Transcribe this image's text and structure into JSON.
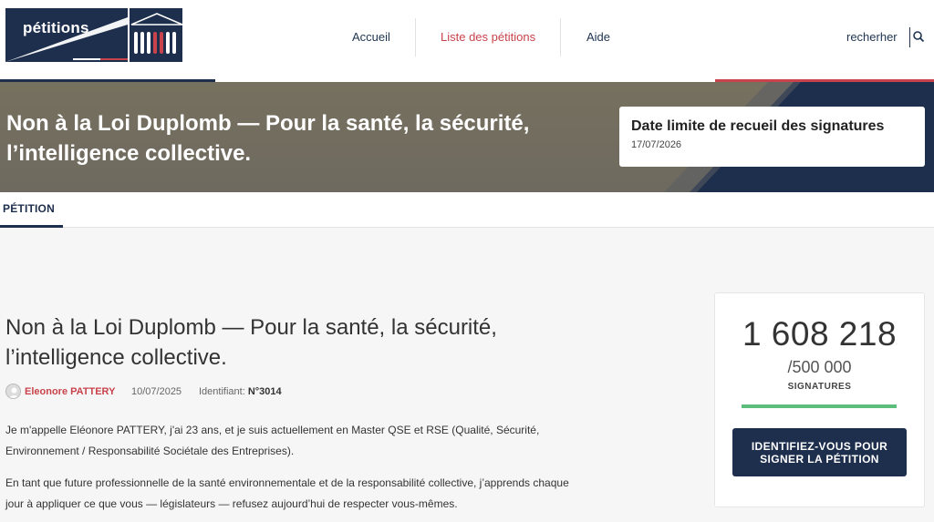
{
  "header": {
    "logo_text": "pétitions",
    "nav": [
      {
        "label": "Accueil",
        "active": false
      },
      {
        "label": "Liste des pétitions",
        "active": true
      },
      {
        "label": "Aide",
        "active": false
      }
    ],
    "search_label": "recherher"
  },
  "banner": {
    "title": "Non à la Loi Duplomb — Pour la santé, la sécurité, l’intelligence collective.",
    "deadline_label": "Date limite de recueil des signatures",
    "deadline_date": "17/07/2026"
  },
  "tabs": [
    {
      "label": "PÉTITION",
      "active": true
    }
  ],
  "petition": {
    "title": "Non à la Loi Duplomb — Pour la santé, la sécurité, l’intelligence collective.",
    "author": "Eleonore PATTERY",
    "date": "10/07/2025",
    "identifier_label": "Identifiant:",
    "identifier": "N°3014",
    "paragraphs": [
      "Je m'appelle Eléonore PATTERY, j'ai 23 ans, et je suis actuellement en Master QSE et RSE (Qualité, Sécurité, Environnement / Responsabilité Sociétale des Entreprises).",
      "En tant que future professionnelle de la santé environnementale et de la responsabilité collective, j’apprends chaque jour à appliquer ce que vous — législateurs — refusez aujourd’hui de respecter vous-mêmes."
    ]
  },
  "signatures": {
    "count": "1 608 218",
    "goal": "/500 000",
    "label": "SIGNATURES",
    "progress_percent": 100,
    "button_label": "IDENTIFIEZ-VOUS POUR SIGNER LA PÉTITION"
  },
  "colors": {
    "navy": "#1e2f4d",
    "accent_red": "#c8434b",
    "progress_green": "#5cbe7a"
  }
}
